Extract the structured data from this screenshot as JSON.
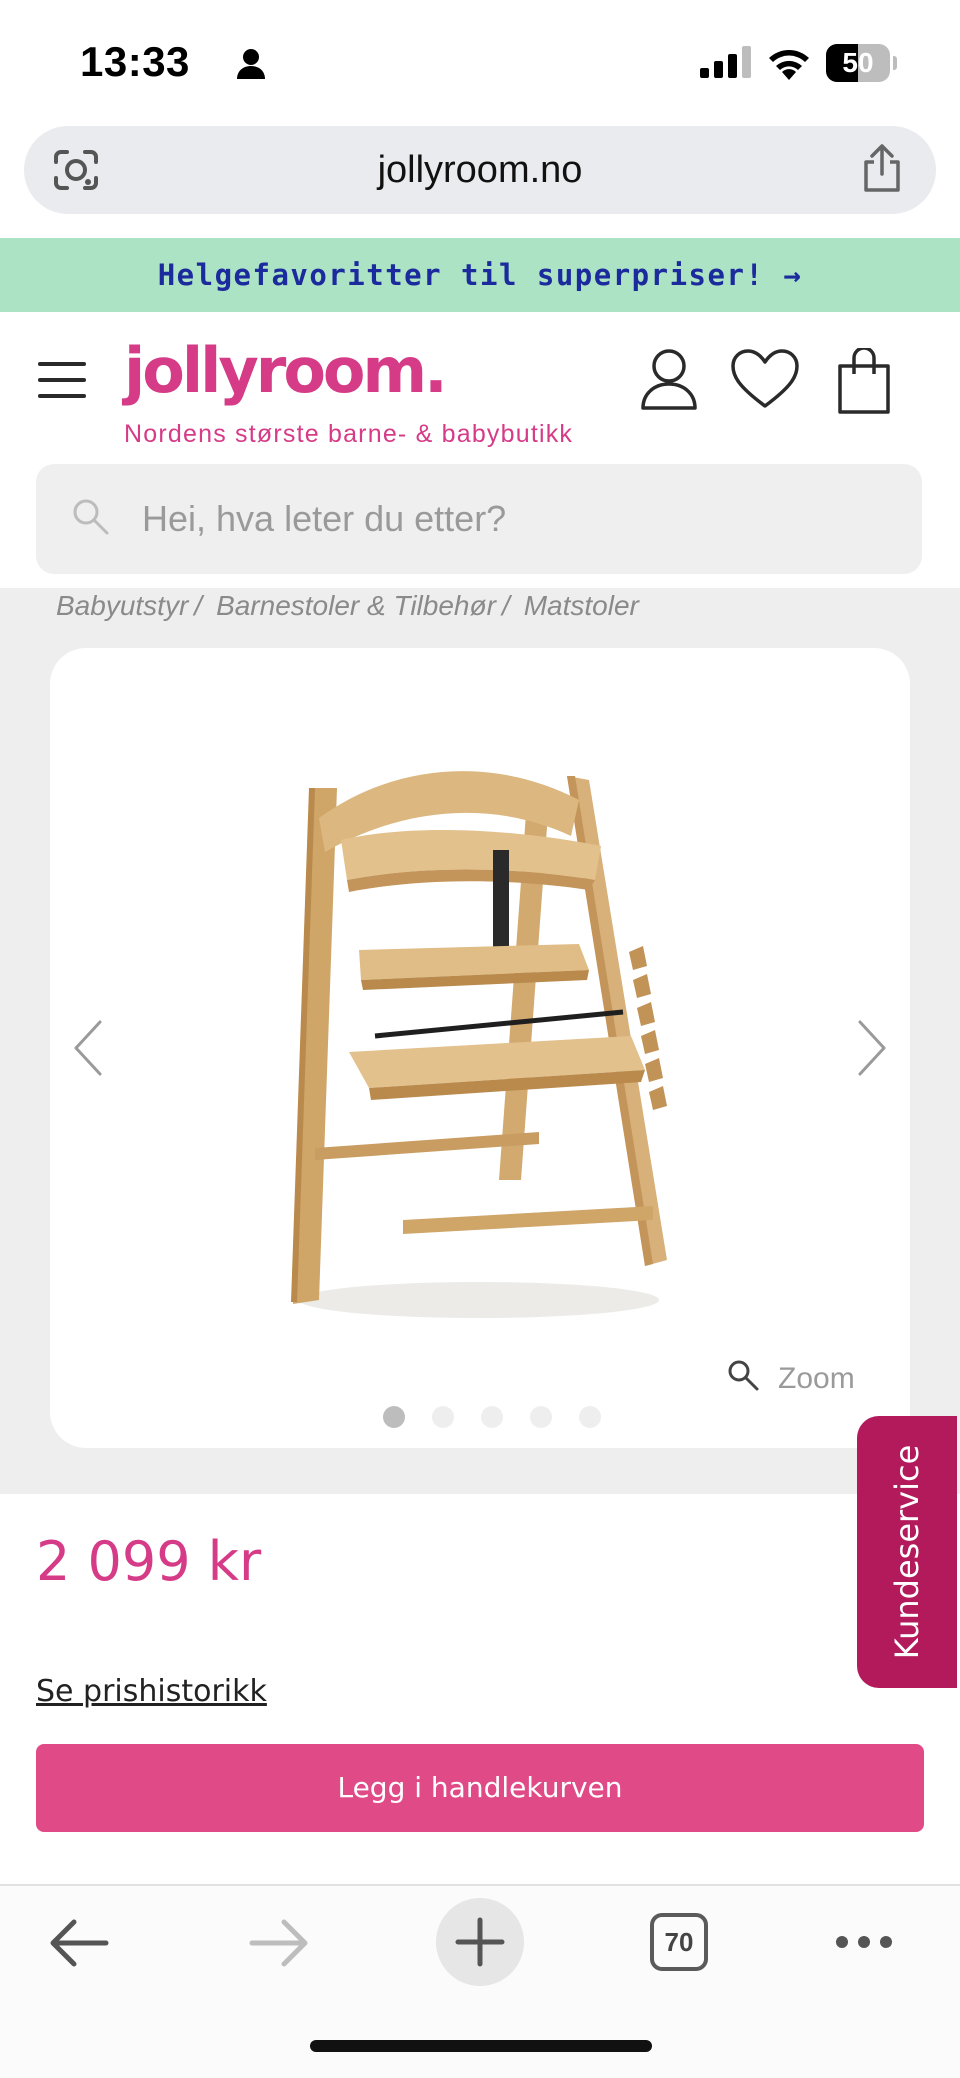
{
  "status_bar": {
    "time": "13:33",
    "battery": "50",
    "battery_level": 0.5
  },
  "browser": {
    "url": "jollyroom.no",
    "icons": [
      "lens-icon",
      "share-icon"
    ]
  },
  "promo": {
    "text": "Helgefavoritter til superpriser! →"
  },
  "header": {
    "logo": "jollyroom.",
    "tagline": "Nordens største barne- & babybutikk",
    "icons": [
      "menu-icon",
      "account-icon",
      "heart-icon",
      "bag-icon"
    ],
    "brand_color": "#d53b87"
  },
  "search": {
    "placeholder": "Hei, hva leter du etter?"
  },
  "breadcrumb": {
    "items": [
      "Babyutstyr",
      "Barnestoler & Tilbehør",
      "Matstoler"
    ],
    "separator": "/"
  },
  "gallery": {
    "zoom_label": "Zoom",
    "slide_count": 5,
    "active_slide": 1
  },
  "product": {
    "price": "2 099 kr",
    "price_history_link": "Se prishistorikk",
    "add_to_cart": "Legg i handlekurven"
  },
  "customer_service": {
    "label": "Kundeservice"
  },
  "toolbar": {
    "tabs_count": "70",
    "icons": [
      "back-icon",
      "forward-icon",
      "plus-icon",
      "tabs-icon",
      "more-icon"
    ]
  }
}
